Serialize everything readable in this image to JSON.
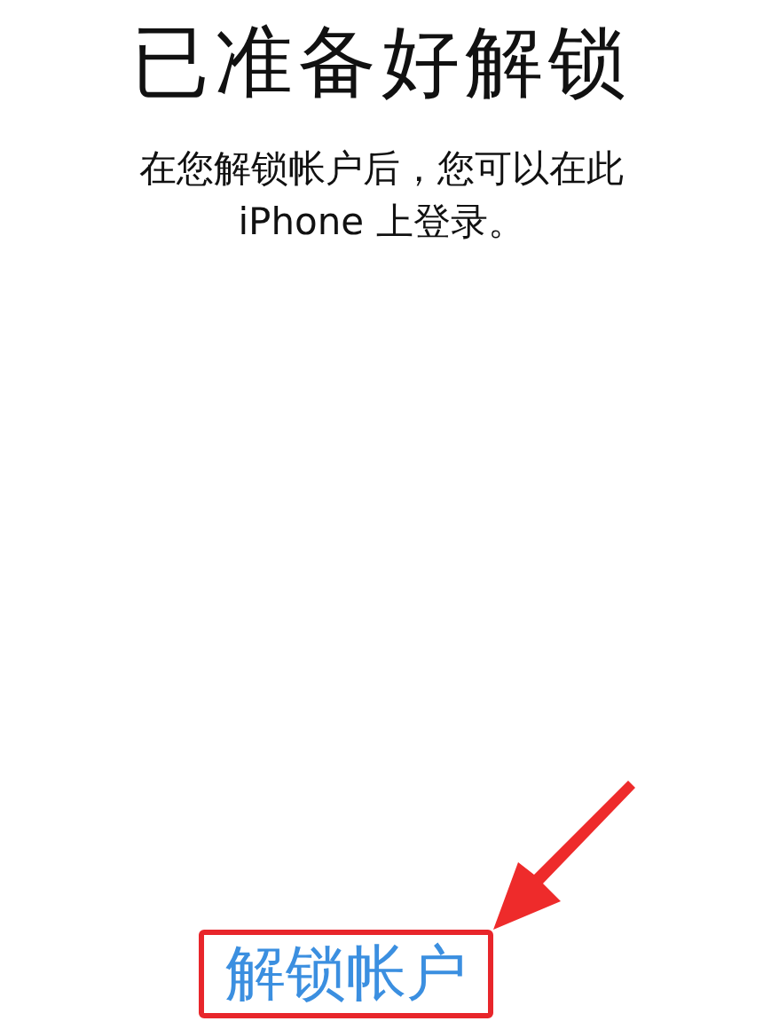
{
  "title": "已准备好解锁",
  "message": "在您解锁帐户后，您可以在此iPhone 上登录。",
  "button": {
    "label": "解锁帐户"
  }
}
